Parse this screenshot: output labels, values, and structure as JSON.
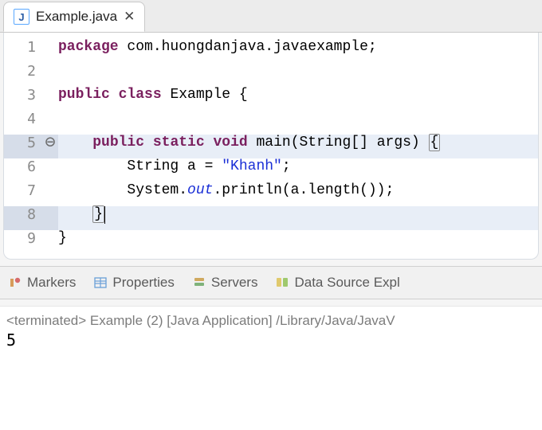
{
  "tab": {
    "filename": "Example.java",
    "icon_letter": "J",
    "close_label": "✕"
  },
  "code": {
    "l1": {
      "num": "1",
      "kw_package": "package",
      "pkg": " com.huongdanjava.javaexample;"
    },
    "l2": {
      "num": "2"
    },
    "l3": {
      "num": "3",
      "kw_public": "public",
      "sp1": " ",
      "kw_class": "class",
      "sp2": " ",
      "cls": "Example",
      "tail": " {"
    },
    "l4": {
      "num": "4"
    },
    "l5": {
      "num": "5",
      "fold": "⊖",
      "indent": "    ",
      "kw_public": "public",
      "sp1": " ",
      "kw_static": "static",
      "sp2": " ",
      "kw_void": "void",
      "sig": " main(String[] args) ",
      "brace": "{"
    },
    "l6": {
      "num": "6",
      "indent": "        ",
      "pre": "String a = ",
      "str": "\"Khanh\"",
      "tail": ";"
    },
    "l7": {
      "num": "7",
      "indent": "        ",
      "pre": "System.",
      "out": "out",
      "tail": ".println(a.length());"
    },
    "l8": {
      "num": "8",
      "indent": "    ",
      "brace": "}"
    },
    "l9": {
      "num": "9",
      "brace": "}"
    }
  },
  "views": {
    "markers": "Markers",
    "properties": "Properties",
    "servers": "Servers",
    "datasource": "Data Source Expl"
  },
  "console": {
    "status": "<terminated> Example (2) [Java Application] /Library/Java/JavaV",
    "output": "5"
  }
}
